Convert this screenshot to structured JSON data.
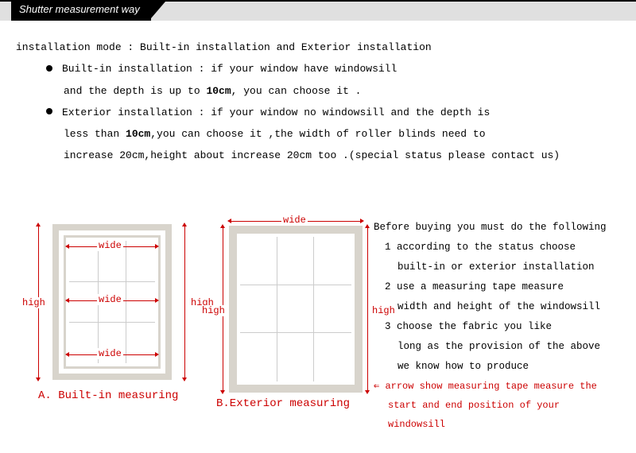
{
  "header": {
    "title": "Shutter measurement way"
  },
  "intro": "installation mode : Built-in installation and Exterior installation",
  "bullets": {
    "b1a": "Built-in installation : if your window have windowsill",
    "b1b": "and the depth is up to ",
    "b1b_bold": "10cm",
    "b1b_tail": ", you can choose it .",
    "b2a": "Exterior installation : if your window no windowsill and the depth is",
    "b2b": "less than ",
    "b2b_bold": "10cm",
    "b2b_tail": ",you can choose it ,the width of roller blinds need to",
    "b2c": "increase 20cm,height about increase 20cm too .(special status please contact us)"
  },
  "labels": {
    "wide": "wide",
    "high": "high",
    "captionA": "A. Built-in measuring",
    "captionB": "B.Exterior measuring"
  },
  "steps": {
    "intro": "Before buying you must do the following",
    "s1": "1 according to the status choose",
    "s1b": "built-in or exterior installation",
    "s2": "2 use a measuring tape measure",
    "s2b": "width and height of the windowsill",
    "s3": "3 choose the fabric you like",
    "s3b": "long as the provision of the above",
    "s3c": "we know how to produce",
    "note1": "arrow show measuring tape measure the",
    "note2": "start and end position of your windowsill"
  }
}
